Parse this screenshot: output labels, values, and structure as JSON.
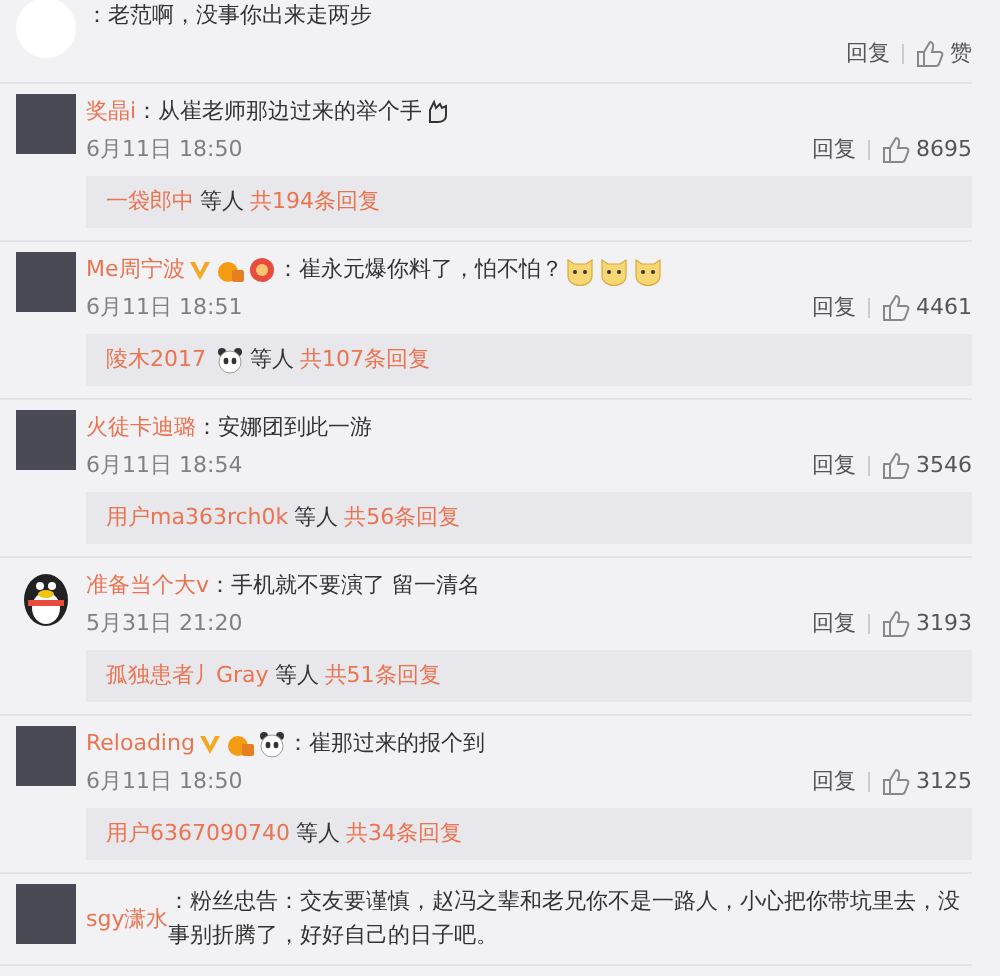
{
  "comments": [
    {
      "avatar": {
        "kind": "blurred"
      },
      "text": "：老范啊，没事你出来走两步",
      "reply": "回复",
      "likes": "赞"
    },
    {
      "name": "奖晶i",
      "avatar": {
        "kind": "photo"
      },
      "text": "：从崔老师那边过来的举个手",
      "emoji": [
        {
          "kind": "hand"
        }
      ],
      "date": "6月11日 18:50",
      "reply": "回复",
      "likes": "8695",
      "thread": {
        "user": "一袋郎中",
        "middle": "等人",
        "count": "共194条回复"
      }
    },
    {
      "name": "Me周宁波",
      "avatar": {
        "kind": "photo"
      },
      "badges": [
        {
          "kind": "verified"
        },
        {
          "kind": "medal"
        },
        {
          "kind": "level"
        }
      ],
      "text": "：崔永元爆你料了，怕不怕？",
      "emoji": [
        {
          "kind": "cat"
        },
        {
          "kind": "cat"
        },
        {
          "kind": "cat"
        }
      ],
      "date": "6月11日 18:51",
      "reply": "回复",
      "likes": "4461",
      "thread": {
        "user": "陵木2017",
        "user_emoji": [
          {
            "kind": "panda"
          }
        ],
        "middle": "等人",
        "count": "共107条回复"
      }
    },
    {
      "name": "火徒卡迪璐",
      "avatar": {
        "kind": "photo"
      },
      "text": "：安娜团到此一游",
      "date": "6月11日 18:54",
      "reply": "回复",
      "likes": "3546",
      "thread": {
        "user": "用户ma363rch0k",
        "middle": "等人",
        "count": "共56条回复"
      }
    },
    {
      "name": "准备当个大v",
      "avatar": {
        "kind": "penguin"
      },
      "text": "：手机就不要演了 留一清名",
      "date": "5月31日 21:20",
      "reply": "回复",
      "likes": "3193",
      "thread": {
        "user": "孤独患者丿Gray",
        "middle": "等人",
        "count": "共51条回复"
      }
    },
    {
      "name": "Reloading",
      "avatar": {
        "kind": "photo"
      },
      "badges": [
        {
          "kind": "verified"
        },
        {
          "kind": "medal"
        },
        {
          "kind": "panda"
        }
      ],
      "text": "：崔那过来的报个到",
      "date": "6月11日 18:50",
      "reply": "回复",
      "likes": "3125",
      "thread": {
        "user": "用户6367090740",
        "middle": "等人",
        "count": "共34条回复"
      }
    },
    {
      "name": "sgy潇水",
      "avatar": {
        "kind": "photo"
      },
      "text": "：粉丝忠告：交友要谨慎，赵冯之辈和老兄你不是一路人，小心把你带坑里去，没事别折腾了，好好自己的日子吧。"
    }
  ]
}
